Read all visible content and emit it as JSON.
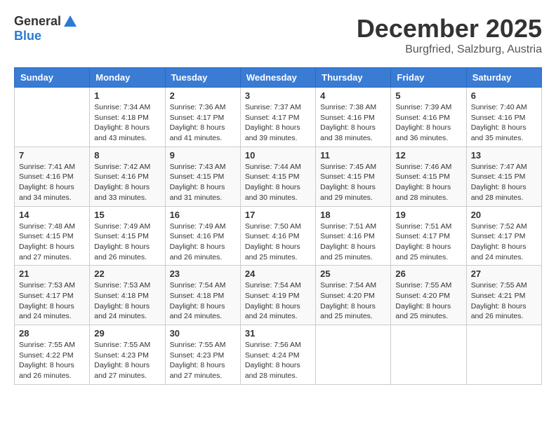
{
  "header": {
    "logo_general": "General",
    "logo_blue": "Blue",
    "month": "December 2025",
    "location": "Burgfried, Salzburg, Austria"
  },
  "days_of_week": [
    "Sunday",
    "Monday",
    "Tuesday",
    "Wednesday",
    "Thursday",
    "Friday",
    "Saturday"
  ],
  "weeks": [
    [
      {
        "day": "",
        "info": ""
      },
      {
        "day": "1",
        "info": "Sunrise: 7:34 AM\nSunset: 4:18 PM\nDaylight: 8 hours\nand 43 minutes."
      },
      {
        "day": "2",
        "info": "Sunrise: 7:36 AM\nSunset: 4:17 PM\nDaylight: 8 hours\nand 41 minutes."
      },
      {
        "day": "3",
        "info": "Sunrise: 7:37 AM\nSunset: 4:17 PM\nDaylight: 8 hours\nand 39 minutes."
      },
      {
        "day": "4",
        "info": "Sunrise: 7:38 AM\nSunset: 4:16 PM\nDaylight: 8 hours\nand 38 minutes."
      },
      {
        "day": "5",
        "info": "Sunrise: 7:39 AM\nSunset: 4:16 PM\nDaylight: 8 hours\nand 36 minutes."
      },
      {
        "day": "6",
        "info": "Sunrise: 7:40 AM\nSunset: 4:16 PM\nDaylight: 8 hours\nand 35 minutes."
      }
    ],
    [
      {
        "day": "7",
        "info": "Sunrise: 7:41 AM\nSunset: 4:16 PM\nDaylight: 8 hours\nand 34 minutes."
      },
      {
        "day": "8",
        "info": "Sunrise: 7:42 AM\nSunset: 4:16 PM\nDaylight: 8 hours\nand 33 minutes."
      },
      {
        "day": "9",
        "info": "Sunrise: 7:43 AM\nSunset: 4:15 PM\nDaylight: 8 hours\nand 31 minutes."
      },
      {
        "day": "10",
        "info": "Sunrise: 7:44 AM\nSunset: 4:15 PM\nDaylight: 8 hours\nand 30 minutes."
      },
      {
        "day": "11",
        "info": "Sunrise: 7:45 AM\nSunset: 4:15 PM\nDaylight: 8 hours\nand 29 minutes."
      },
      {
        "day": "12",
        "info": "Sunrise: 7:46 AM\nSunset: 4:15 PM\nDaylight: 8 hours\nand 28 minutes."
      },
      {
        "day": "13",
        "info": "Sunrise: 7:47 AM\nSunset: 4:15 PM\nDaylight: 8 hours\nand 28 minutes."
      }
    ],
    [
      {
        "day": "14",
        "info": "Sunrise: 7:48 AM\nSunset: 4:15 PM\nDaylight: 8 hours\nand 27 minutes."
      },
      {
        "day": "15",
        "info": "Sunrise: 7:49 AM\nSunset: 4:15 PM\nDaylight: 8 hours\nand 26 minutes."
      },
      {
        "day": "16",
        "info": "Sunrise: 7:49 AM\nSunset: 4:16 PM\nDaylight: 8 hours\nand 26 minutes."
      },
      {
        "day": "17",
        "info": "Sunrise: 7:50 AM\nSunset: 4:16 PM\nDaylight: 8 hours\nand 25 minutes."
      },
      {
        "day": "18",
        "info": "Sunrise: 7:51 AM\nSunset: 4:16 PM\nDaylight: 8 hours\nand 25 minutes."
      },
      {
        "day": "19",
        "info": "Sunrise: 7:51 AM\nSunset: 4:17 PM\nDaylight: 8 hours\nand 25 minutes."
      },
      {
        "day": "20",
        "info": "Sunrise: 7:52 AM\nSunset: 4:17 PM\nDaylight: 8 hours\nand 24 minutes."
      }
    ],
    [
      {
        "day": "21",
        "info": "Sunrise: 7:53 AM\nSunset: 4:17 PM\nDaylight: 8 hours\nand 24 minutes."
      },
      {
        "day": "22",
        "info": "Sunrise: 7:53 AM\nSunset: 4:18 PM\nDaylight: 8 hours\nand 24 minutes."
      },
      {
        "day": "23",
        "info": "Sunrise: 7:54 AM\nSunset: 4:18 PM\nDaylight: 8 hours\nand 24 minutes."
      },
      {
        "day": "24",
        "info": "Sunrise: 7:54 AM\nSunset: 4:19 PM\nDaylight: 8 hours\nand 24 minutes."
      },
      {
        "day": "25",
        "info": "Sunrise: 7:54 AM\nSunset: 4:20 PM\nDaylight: 8 hours\nand 25 minutes."
      },
      {
        "day": "26",
        "info": "Sunrise: 7:55 AM\nSunset: 4:20 PM\nDaylight: 8 hours\nand 25 minutes."
      },
      {
        "day": "27",
        "info": "Sunrise: 7:55 AM\nSunset: 4:21 PM\nDaylight: 8 hours\nand 26 minutes."
      }
    ],
    [
      {
        "day": "28",
        "info": "Sunrise: 7:55 AM\nSunset: 4:22 PM\nDaylight: 8 hours\nand 26 minutes."
      },
      {
        "day": "29",
        "info": "Sunrise: 7:55 AM\nSunset: 4:23 PM\nDaylight: 8 hours\nand 27 minutes."
      },
      {
        "day": "30",
        "info": "Sunrise: 7:55 AM\nSunset: 4:23 PM\nDaylight: 8 hours\nand 27 minutes."
      },
      {
        "day": "31",
        "info": "Sunrise: 7:56 AM\nSunset: 4:24 PM\nDaylight: 8 hours\nand 28 minutes."
      },
      {
        "day": "",
        "info": ""
      },
      {
        "day": "",
        "info": ""
      },
      {
        "day": "",
        "info": ""
      }
    ]
  ]
}
